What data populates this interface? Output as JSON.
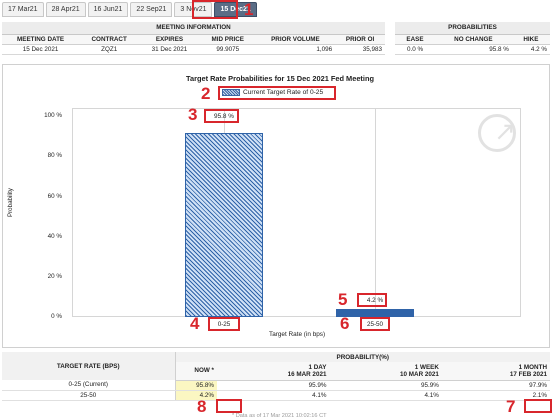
{
  "tabs": [
    {
      "label": "17 Mar21"
    },
    {
      "label": "28 Apr21"
    },
    {
      "label": "16 Jun21"
    },
    {
      "label": "22 Sep21"
    },
    {
      "label": "3 Nov21"
    },
    {
      "label": "15 Dec21",
      "active": true
    }
  ],
  "meeting_info": {
    "header": "MEETING INFORMATION",
    "columns": [
      "MEETING DATE",
      "CONTRACT",
      "EXPIRES",
      "MID PRICE",
      "PRIOR VOLUME",
      "PRIOR OI"
    ],
    "values": [
      "15 Dec 2021",
      "ZQZ1",
      "31 Dec 2021",
      "99.9075",
      "1,096",
      "35,983"
    ]
  },
  "probabilities": {
    "header": "PROBABILITIES",
    "columns": [
      "EASE",
      "NO CHANGE",
      "HIKE"
    ],
    "values": [
      "0.0 %",
      "95.8 %",
      "4.2 %"
    ]
  },
  "chart_data": {
    "type": "bar",
    "title": "Target Rate Probabilities for 15 Dec 2021 Fed Meeting",
    "legend": "Current Target Rate of 0-25",
    "categories": [
      "0-25",
      "25-50"
    ],
    "values": [
      95.8,
      4.2
    ],
    "data_labels": [
      "95.8 %",
      "4.2 %"
    ],
    "xlabel": "Target Rate (in bps)",
    "ylabel": "Probability",
    "yticks": [
      "100 %",
      "80 %",
      "60 %",
      "40 %",
      "20 %",
      "0 %"
    ],
    "ylim": [
      0,
      100
    ]
  },
  "annotations": [
    "1",
    "2",
    "3",
    "4",
    "5",
    "6",
    "7",
    "8"
  ],
  "bottom_table": {
    "rate_header": "TARGET RATE (BPS)",
    "prob_header": "PROBABILITY(%)",
    "sub_headers": [
      {
        "line1": "NOW *",
        "line2": ""
      },
      {
        "line1": "1 DAY",
        "line2": "16 MAR 2021"
      },
      {
        "line1": "1 WEEK",
        "line2": "10 MAR 2021"
      },
      {
        "line1": "1 MONTH",
        "line2": "17 FEB 2021"
      }
    ],
    "rows": [
      {
        "rate": "0-25 (Current)",
        "values": [
          "95.8%",
          "95.9%",
          "95.9%",
          "97.9%"
        ]
      },
      {
        "rate": "25-50",
        "values": [
          "4.2%",
          "4.1%",
          "4.1%",
          "2.1%"
        ]
      }
    ]
  },
  "footer": "* Data as of 17 Mar 2021 10:02:16 CT",
  "colors": {
    "accent": "#d8262c",
    "bar": "#2f63a8",
    "tab_active": "#5a6d86",
    "highlight": "#fbf7c2"
  }
}
